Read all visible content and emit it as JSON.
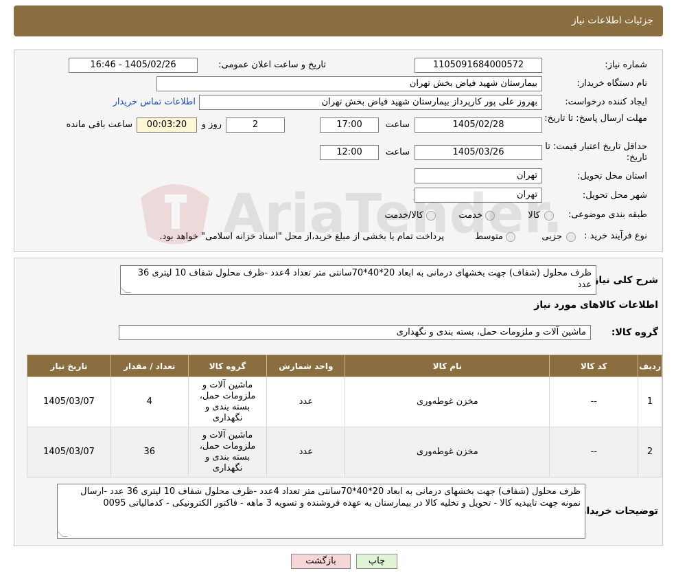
{
  "header": {
    "title": "جزئیات اطلاعات نیاز"
  },
  "form": {
    "need_number_label": "شماره نیاز:",
    "need_number": "1105091684000572",
    "announce_label": "تاریخ و ساعت اعلان عمومی:",
    "announce_value": "1405/02/26 - 16:46",
    "buyer_org_label": "نام دستگاه خریدار:",
    "buyer_org": "بیمارستان شهید فیاض بخش تهران",
    "requester_label": "ایجاد کننده درخواست:",
    "requester": "بهروز علی پور کارپرداز بیمارستان شهید فیاض بخش تهران",
    "contact_link": "اطلاعات تماس خریدار",
    "deadline_label": "مهلت ارسال پاسخ: تا تاریخ:",
    "deadline_date": "1405/02/28",
    "time_label": "ساعت",
    "deadline_time": "17:00",
    "days_value": "2",
    "days_label": "روز و",
    "remaining_time": "00:03:20",
    "remaining_label": "ساعت باقی مانده",
    "validity_label": "حداقل تاریخ اعتبار قیمت: تا تاریخ:",
    "validity_date": "1405/03/26",
    "validity_time": "12:00",
    "province_label": "استان محل تحویل:",
    "province": "تهران",
    "city_label": "شهر محل تحویل:",
    "city": "تهران",
    "category_label": "طبقه بندی موضوعی:",
    "category_options": [
      "کالا",
      "خدمت",
      "کالا/خدمت"
    ],
    "process_label": "نوع فرآیند خرید :",
    "process_options": [
      "جزیی",
      "متوسط"
    ],
    "process_note": "پرداخت تمام یا بخشی از مبلغ خرید،از محل \"اسناد خزانه اسلامی\" خواهد بود."
  },
  "details": {
    "summary_label": "شرح کلی نیاز:",
    "summary": "ظرف محلول (شفاف) جهت بخشهای درمانی به ابعاد 20*40*70سانتی متر تعداد 4عدد -ظرف محلول شفاف 10 لیتری 36 عدد",
    "goods_info_title": "اطلاعات کالاهای مورد نیاز",
    "goods_group_label": "گروه کالا:",
    "goods_group": "ماشین آلات و ملزومات حمل، بسته بندی و نگهداری",
    "table": {
      "headers": [
        "ردیف",
        "کد کالا",
        "نام کالا",
        "واحد شمارش",
        "گروه کالا",
        "تعداد / مقدار",
        "تاریخ نیاز"
      ],
      "rows": [
        [
          "1",
          "--",
          "مخزن غوطه‌وری",
          "عدد",
          "ماشین آلات و ملزومات حمل، بسته بندی و نگهداری",
          "4",
          "1405/03/07"
        ],
        [
          "2",
          "--",
          "مخزن غوطه‌وری",
          "عدد",
          "ماشین آلات و ملزومات حمل، بسته بندی و نگهداری",
          "36",
          "1405/03/07"
        ]
      ]
    },
    "buyer_notes_label": "توضیحات خریدار:",
    "buyer_notes": "ظرف محلول (شفاف) جهت بخشهای درمانی به ابعاد 20*40*70سانتی متر تعداد 4عدد -ظرف محلول شفاف 10 لیتری 36 عدد -ارسال نمونه جهت تاییدیه کالا - تحویل و تخلیه کالا در بیمارستان به عهده فروشنده و تسویه 3 ماهه - فاکتور الکترونیکی - کدمالیاتی 0095"
  },
  "buttons": {
    "print": "چاپ",
    "back": "بازگشت"
  },
  "colors": {
    "header_bg": "#8b6e3f",
    "back_button_bg": "#f6d7d7",
    "print_button_bg": "#e0f5d6",
    "link": "#1a4fb3"
  },
  "watermark": {
    "text": "AriaTender.neT"
  }
}
